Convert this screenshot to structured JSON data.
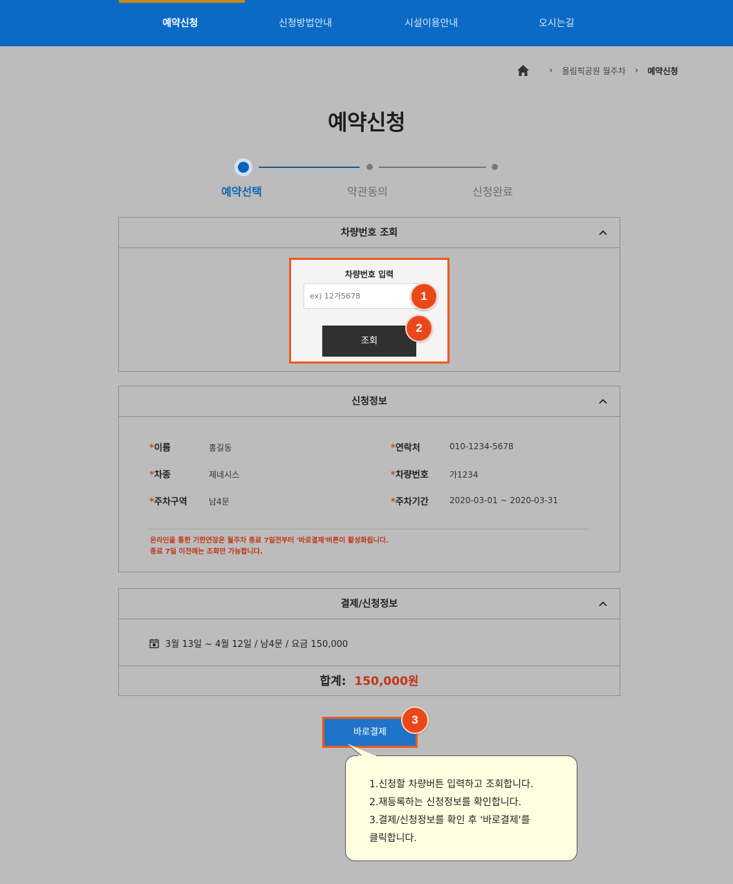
{
  "nav": {
    "items": [
      {
        "label": "예약신청",
        "active": true
      },
      {
        "label": "신청방법안내",
        "active": false
      },
      {
        "label": "시설이용안내",
        "active": false
      },
      {
        "label": "오시는길",
        "active": false
      }
    ]
  },
  "breadcrumb": {
    "home_icon": "home-icon",
    "items": [
      "올림픽공원 월주차",
      "예약신청"
    ]
  },
  "page_title": "예약신청",
  "steps": [
    {
      "label": "예약선택",
      "state": "active"
    },
    {
      "label": "약관동의",
      "state": "pending"
    },
    {
      "label": "신청완료",
      "state": "pending"
    }
  ],
  "vehicle_lookup": {
    "title": "차량번호 조회",
    "input_label": "차량번호 입력",
    "placeholder": "ex) 12가5678",
    "button": "조회"
  },
  "application_info": {
    "title": "신청정보",
    "fields": {
      "name": {
        "key": "이름",
        "value": "홍길동"
      },
      "phone": {
        "key": "연락처",
        "value": "010-1234-5678"
      },
      "car_type": {
        "key": "차종",
        "value": "제네시스"
      },
      "car_number": {
        "key": "차량번호",
        "value": "가1234"
      },
      "zone": {
        "key": "주차구역",
        "value": "남4문"
      },
      "period": {
        "key": "주차기간",
        "value": "2020-03-01 ~ 2020-03-31"
      }
    },
    "required_mark": "*",
    "notice_line1": "온라인을 통한 기한연장은 월주차 종료 7일전부터 '바로결제'버튼이 활성화됩니다.",
    "notice_line2": "종료 7일 이전에는 조회만 가능합니다."
  },
  "payment_info": {
    "title": "결제/신청정보",
    "summary": "3월 13일 ~ 4월 12일 / 남4문 / 요금 150,000",
    "total_label": "합계:",
    "total_amount": "150,000원"
  },
  "pay_button": "바로결제",
  "badges": [
    "1",
    "2",
    "3"
  ],
  "tooltip": {
    "lines": [
      "1.신청할 차량버튼 입력하고 조회합니다.",
      "2.재등록하는 신청정보를 확인합니다.",
      "3.결제/신청정보를 확인 후 '바로결제'를",
      "클릭합니다."
    ]
  },
  "colors": {
    "nav_bg": "#0a6ac6",
    "accent": "#c98a14",
    "highlight": "#ec5a1d",
    "badge": "#e9491a",
    "step_active": "#0b63bf",
    "price": "#c1361a",
    "tooltip_bg": "#fffee0"
  }
}
